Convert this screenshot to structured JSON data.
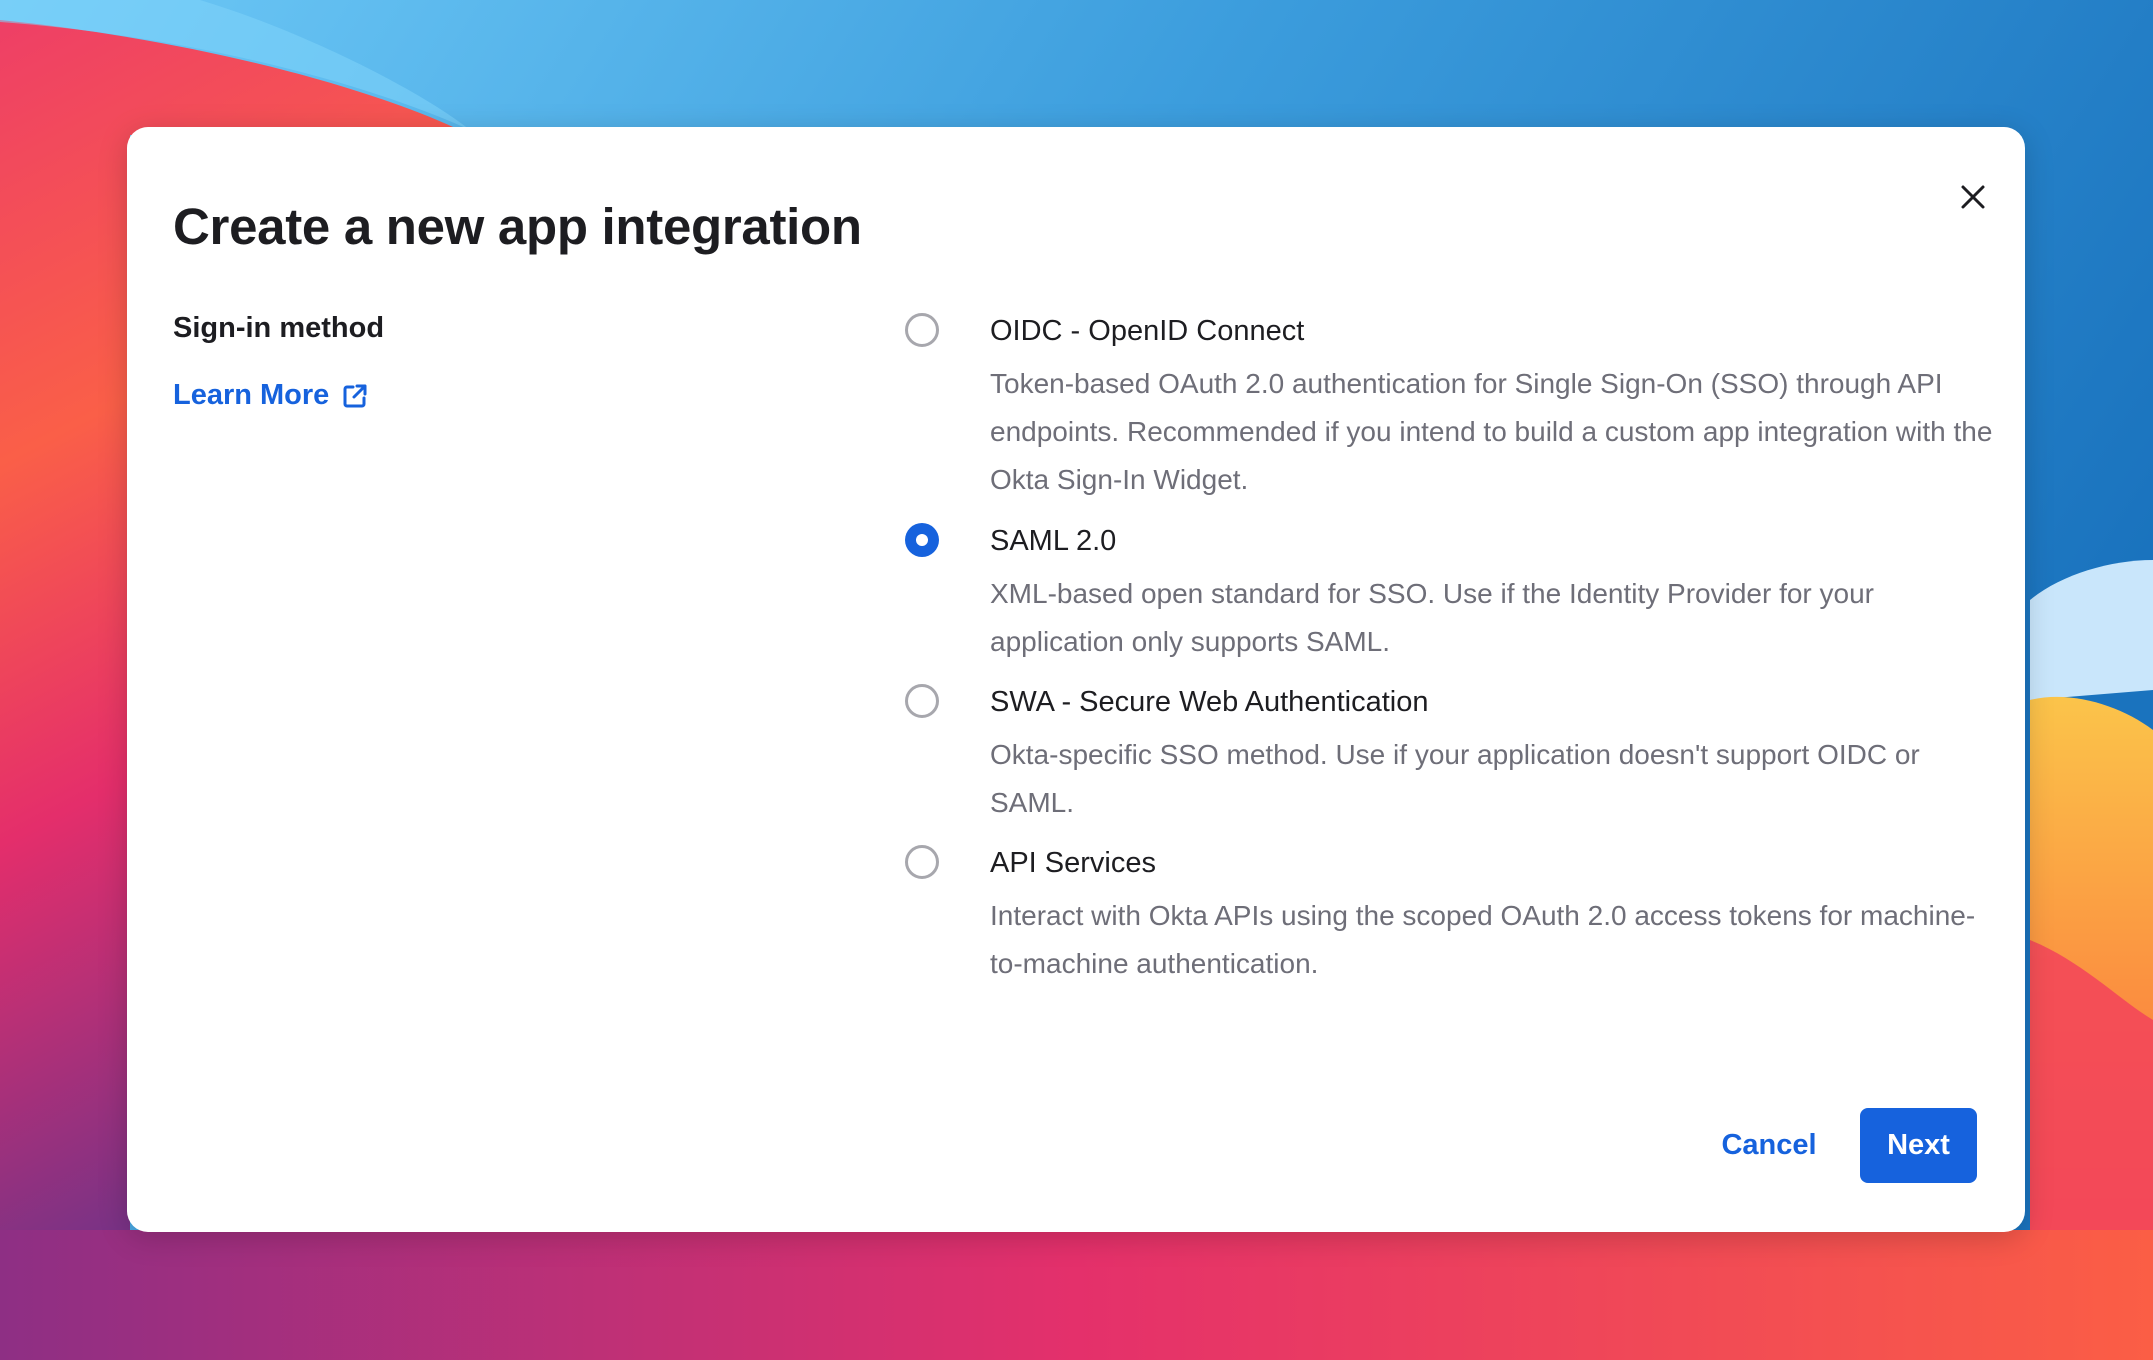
{
  "dialog": {
    "title": "Create a new app integration",
    "close_icon": "close-icon"
  },
  "left_column": {
    "section_label": "Sign-in method",
    "learn_more": {
      "label": "Learn More",
      "icon": "external-link-icon"
    }
  },
  "sign_in_methods": {
    "selected": "SAML 2.0",
    "options": [
      {
        "label": "OIDC - OpenID Connect",
        "description": "Token-based OAuth 2.0 authentication for Single Sign-On (SSO) through API endpoints. Recommended if you intend to build a custom app integration with the Okta Sign-In Widget.",
        "checked": false
      },
      {
        "label": "SAML 2.0",
        "description": "XML-based open standard for SSO. Use if the Identity Provider for your application only supports SAML.",
        "checked": true
      },
      {
        "label": "SWA - Secure Web Authentication",
        "description": "Okta-specific SSO method. Use if your application doesn't support OIDC or SAML.",
        "checked": false
      },
      {
        "label": "API Services",
        "description": "Interact with Okta APIs using the scoped OAuth 2.0 access tokens for machine-to-machine authentication.",
        "checked": false
      }
    ]
  },
  "footer": {
    "cancel_label": "Cancel",
    "next_label": "Next"
  },
  "colors": {
    "primary": "#1662dd",
    "title_text": "#1d1d21",
    "description_text": "#6e6e78",
    "radio_border": "#a7a7ad"
  }
}
